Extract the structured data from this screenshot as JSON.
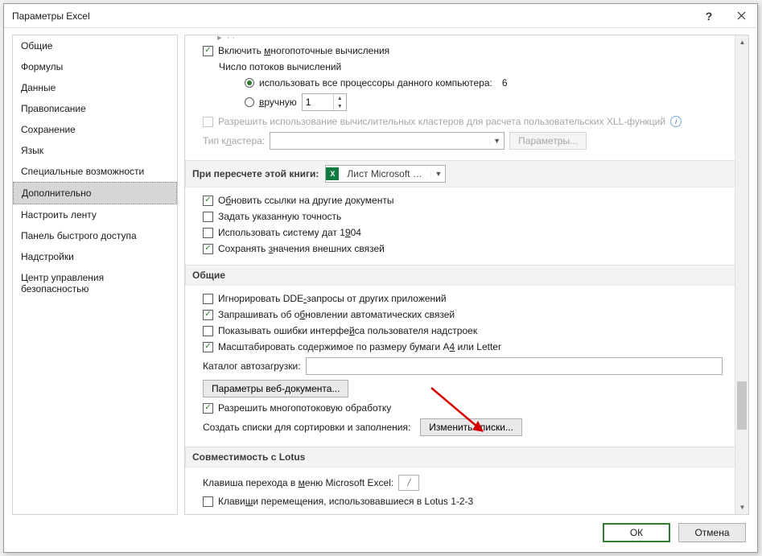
{
  "window": {
    "title": "Параметры Excel"
  },
  "sidebar": {
    "items": [
      {
        "label": "Общие"
      },
      {
        "label": "Формулы"
      },
      {
        "label": "Данные"
      },
      {
        "label": "Правописание"
      },
      {
        "label": "Сохранение"
      },
      {
        "label": "Язык"
      },
      {
        "label": "Специальные возможности"
      },
      {
        "label": "Дополнительно"
      },
      {
        "label": "Настроить ленту"
      },
      {
        "label": "Панель быстрого доступа"
      },
      {
        "label": "Надстройки"
      },
      {
        "label": "Центр управления безопасностью"
      }
    ],
    "selected_index": 7
  },
  "calc": {
    "multithread_label": "Включить многопоточные вычисления",
    "multithread_accel": "м",
    "threads_label": "Число потоков вычислений",
    "use_all_label": "использовать все процессоры данного компьютера:",
    "cpu_count": "6",
    "manual_label": "вручную",
    "manual_accel": "в",
    "manual_value": "1",
    "cluster_allow_label": "Разрешить использование вычислительных кластеров для расчета пользовательских XLL-функций",
    "cluster_type_label": "Тип кластера:",
    "cluster_accel": "л",
    "cluster_params_btn": "Параметры..."
  },
  "recalc": {
    "header_label": "При пересчете этой книги:",
    "book_name": "Лист Microsoft Ex...",
    "items": [
      {
        "checked": true,
        "label": "Обновить ссылки на другие документы",
        "accel": "б"
      },
      {
        "checked": false,
        "label": "Задать указанную точность"
      },
      {
        "checked": false,
        "label": "Использовать систему дат 1904",
        "accel_fragment": "9"
      },
      {
        "checked": true,
        "label": "Сохранять значения внешних связей",
        "accel": "з"
      }
    ]
  },
  "general": {
    "header_label": "Общие",
    "items": [
      {
        "checked": false,
        "label": "Игнорировать DDE-запросы от других приложений",
        "accel_after": "DDE-"
      },
      {
        "checked": true,
        "label": "Запрашивать об обновлении автоматических связей",
        "accel": "б"
      },
      {
        "checked": false,
        "label": "Показывать ошибки интерфейса пользователя надстроек",
        "accel": "й"
      },
      {
        "checked": true,
        "label": "Масштабировать содержимое по размеру бумаги A4 или Letter",
        "accel": "4"
      }
    ],
    "autostart_label": "Каталог автозагрузки:",
    "webdoc_btn": "Параметры веб-документа...",
    "multiproc_label": "Разрешить многопотоковую обработку",
    "multiproc_checked": true,
    "sort_label": "Создать списки для сортировки и заполнения:",
    "sort_btn": "Изменить списки..."
  },
  "lotus": {
    "header_label": "Совместимость с Lotus",
    "menu_key_label": "Клавиша перехода в меню Microsoft Excel:",
    "menu_key_value": "/",
    "nav_label": "Клавиши перемещения, использовавшиеся в Lotus 1-2-3",
    "accel": "м",
    "accel2": "ш"
  },
  "footer": {
    "ok": "ОК",
    "cancel": "Отмена"
  }
}
